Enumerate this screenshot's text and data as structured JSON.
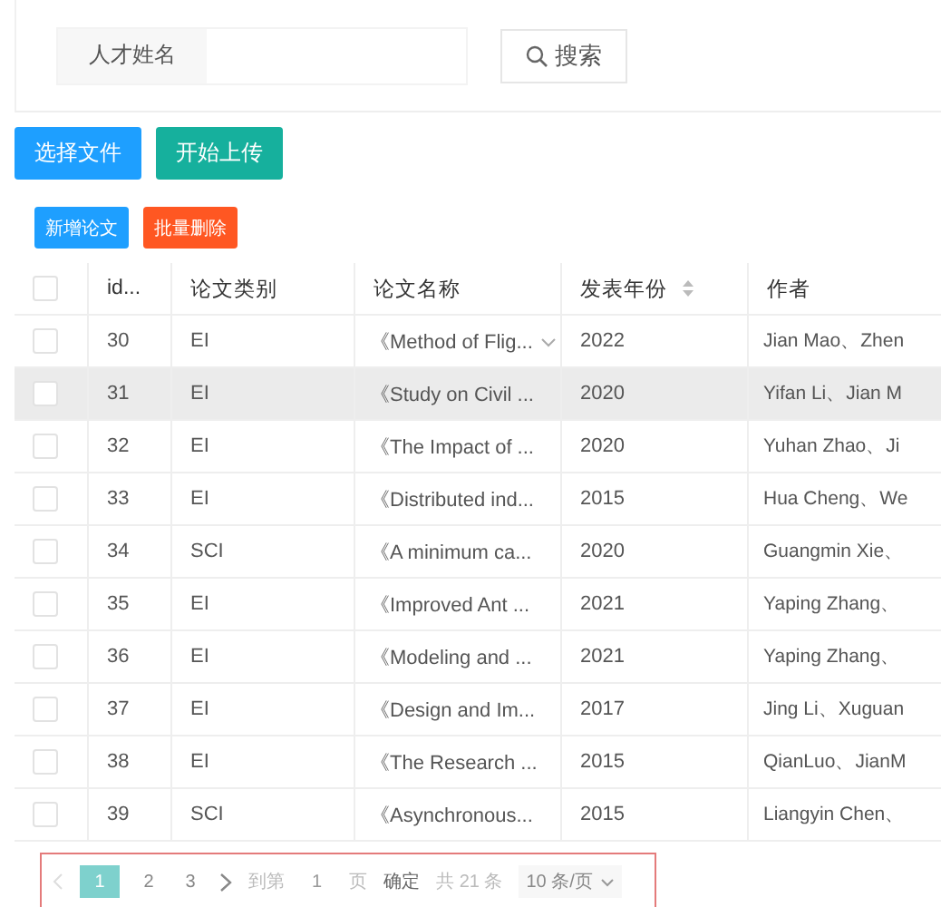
{
  "search": {
    "label": "人才姓名",
    "button": "搜索"
  },
  "upload_buttons": [
    {
      "label": "选择文件",
      "kind": "primary"
    },
    {
      "label": "开始上传",
      "kind": "success"
    }
  ],
  "toolbar_buttons": [
    {
      "label": "新增论文",
      "kind": "primary"
    },
    {
      "label": "批量删除",
      "kind": "danger"
    }
  ],
  "table": {
    "all_checked": false,
    "columns": [
      {
        "label": "id...",
        "sortable": false
      },
      {
        "label": "论文类别",
        "sortable": false
      },
      {
        "label": "论文名称",
        "sortable": false
      },
      {
        "label": "发表年份",
        "sortable": true
      },
      {
        "label": "作者",
        "sortable": false
      }
    ],
    "rows": [
      {
        "checked": false,
        "hovered": false,
        "menu": true,
        "cells": [
          "30",
          "EI",
          "《Method of Flig...",
          "2022",
          "Jian Mao、Zhen"
        ]
      },
      {
        "checked": false,
        "hovered": true,
        "menu": false,
        "cells": [
          "31",
          "EI",
          "《Study on Civil ...",
          "2020",
          "Yifan Li、Jian M"
        ]
      },
      {
        "checked": false,
        "hovered": false,
        "menu": false,
        "cells": [
          "32",
          "EI",
          "《The Impact of ...",
          "2020",
          "Yuhan Zhao、Ji"
        ]
      },
      {
        "checked": false,
        "hovered": false,
        "menu": false,
        "cells": [
          "33",
          "EI",
          "《Distributed ind...",
          "2015",
          "Hua Cheng、We"
        ]
      },
      {
        "checked": false,
        "hovered": false,
        "menu": false,
        "cells": [
          "34",
          "SCI",
          "《A minimum ca...",
          "2020",
          "Guangmin Xie、"
        ]
      },
      {
        "checked": false,
        "hovered": false,
        "menu": false,
        "cells": [
          "35",
          "EI",
          "《Improved Ant ...",
          "2021",
          "Yaping Zhang、"
        ]
      },
      {
        "checked": false,
        "hovered": false,
        "menu": false,
        "cells": [
          "36",
          "EI",
          "《Modeling and ...",
          "2021",
          "Yaping Zhang、"
        ]
      },
      {
        "checked": false,
        "hovered": false,
        "menu": false,
        "cells": [
          "37",
          "EI",
          "《Design and Im...",
          "2017",
          "Jing Li、Xuguan"
        ]
      },
      {
        "checked": false,
        "hovered": false,
        "menu": false,
        "cells": [
          "38",
          "EI",
          "《The Research ...",
          "2015",
          "QianLuo、JianM"
        ]
      },
      {
        "checked": false,
        "hovered": false,
        "menu": false,
        "cells": [
          "39",
          "SCI",
          "《Asynchronous...",
          "2015",
          "Liangyin Chen、"
        ]
      }
    ]
  },
  "pagination": {
    "pages": [
      {
        "label": "1",
        "selected": true
      },
      {
        "label": "2",
        "selected": false
      },
      {
        "label": "3",
        "selected": false
      }
    ],
    "goto_label": "到第",
    "goto_value": "1",
    "page_unit": "页",
    "confirm": "确定",
    "total": "共 21 条",
    "page_size": "10 条/页"
  }
}
